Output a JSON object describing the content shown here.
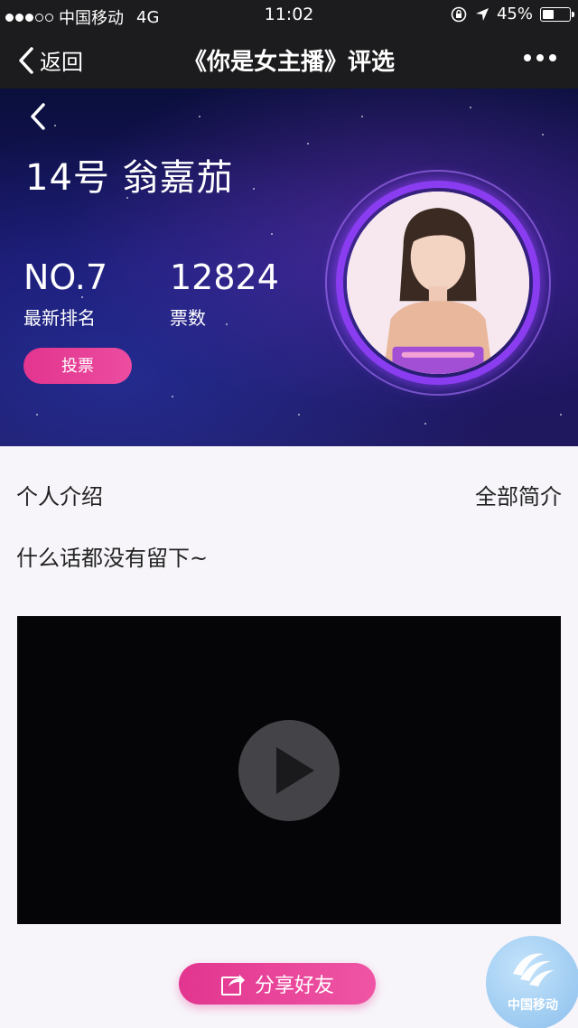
{
  "status_bar": {
    "carrier": "中国移动",
    "network": "4G",
    "time": "11:02",
    "battery_percent_label": "45%",
    "battery_level": 0.45
  },
  "nav": {
    "back_label": "返回",
    "title": "《你是女主播》评选"
  },
  "candidate": {
    "name": "14号  翁嘉茄",
    "rank_value": "NO.7",
    "rank_label": "最新排名",
    "votes_value": "12824",
    "votes_label": "票数",
    "vote_button": "投票"
  },
  "profile": {
    "section_title": "个人介绍",
    "full_intro_link": "全部简介",
    "intro_text": "什么话都没有留下~"
  },
  "share": {
    "label": "分享好友"
  },
  "badge": {
    "label": "中国移动"
  },
  "colors": {
    "accent_pink": "#e2358f",
    "ring_purple": "#8a3df0",
    "hero_dark": "#1a1466"
  }
}
